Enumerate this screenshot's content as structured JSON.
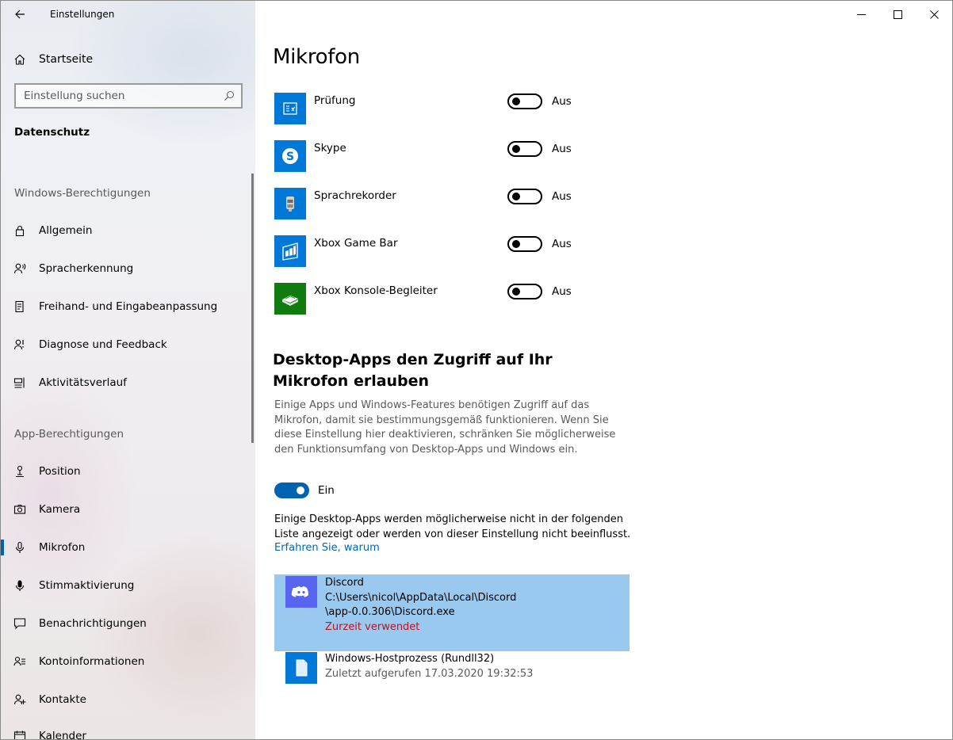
{
  "window": {
    "title": "Einstellungen"
  },
  "sidebar": {
    "home_label": "Startseite",
    "search_placeholder": "Einstellung suchen",
    "section_title": "Datenschutz",
    "group_windows": "Windows-Berechtigungen",
    "group_apps": "App-Berechtigungen",
    "windows_items": [
      {
        "label": "Allgemein",
        "icon": "lock-icon"
      },
      {
        "label": "Spracherkennung",
        "icon": "speech-icon"
      },
      {
        "label": "Freihand- und Eingabeanpassung",
        "icon": "pen-input-icon"
      },
      {
        "label": "Diagnose und Feedback",
        "icon": "feedback-icon"
      },
      {
        "label": "Aktivitätsverlauf",
        "icon": "timeline-icon"
      }
    ],
    "app_items": [
      {
        "label": "Position",
        "icon": "location-icon"
      },
      {
        "label": "Kamera",
        "icon": "camera-icon"
      },
      {
        "label": "Mikrofon",
        "icon": "microphone-icon",
        "active": true
      },
      {
        "label": "Stimmaktivierung",
        "icon": "voice-activation-icon"
      },
      {
        "label": "Benachrichtigungen",
        "icon": "notification-icon"
      },
      {
        "label": "Kontoinformationen",
        "icon": "account-info-icon"
      },
      {
        "label": "Kontakte",
        "icon": "contacts-icon"
      },
      {
        "label": "Kalender",
        "icon": "calendar-icon"
      }
    ]
  },
  "main": {
    "title": "Mikrofon",
    "apps": [
      {
        "name": "Prüfung",
        "state": "Aus",
        "color": "#0078d7",
        "icon": "test-icon"
      },
      {
        "name": "Skype",
        "state": "Aus",
        "color": "#0078d7",
        "icon": "skype-icon"
      },
      {
        "name": "Sprachrekorder",
        "state": "Aus",
        "color": "#0078d7",
        "icon": "voice-recorder-icon"
      },
      {
        "name": "Xbox Game Bar",
        "state": "Aus",
        "color": "#0078d7",
        "icon": "xbox-game-bar-icon"
      },
      {
        "name": "Xbox Konsole-Begleiter",
        "state": "Aus",
        "color": "#107c10",
        "icon": "xbox-console-icon"
      }
    ],
    "desktop_heading": "Desktop-Apps den Zugriff auf Ihr Mikrofon erlauben",
    "desktop_description": "Einige Apps und Windows-Features benötigen Zugriff auf das Mikrofon, damit sie bestimmungsgemäß funktionieren. Wenn Sie diese Einstellung hier deaktivieren, schränken Sie möglicherweise den Funktionsumfang von Desktop-Apps und Windows ein.",
    "desktop_toggle_state": "Ein",
    "desktop_note": "Einige Desktop-Apps werden möglicherweise nicht in der folgenden Liste angezeigt oder werden von dieser Einstellung nicht beeinflusst.",
    "learn_more": "Erfahren Sie, warum",
    "desktop_apps": [
      {
        "name": "Discord",
        "path_line1": "C:\\Users\\nicol\\AppData\\Local\\Discord",
        "path_line2": "\\app-0.0.306\\Discord.exe",
        "status": "Zurzeit verwendet",
        "icon": "discord-icon",
        "color": "#5865f2"
      },
      {
        "name": "Windows-Hostprozess (Rundll32)",
        "meta": "Zuletzt aufgerufen 17.03.2020 19:32:53",
        "icon": "file-icon",
        "color": "#0078d7"
      }
    ]
  }
}
